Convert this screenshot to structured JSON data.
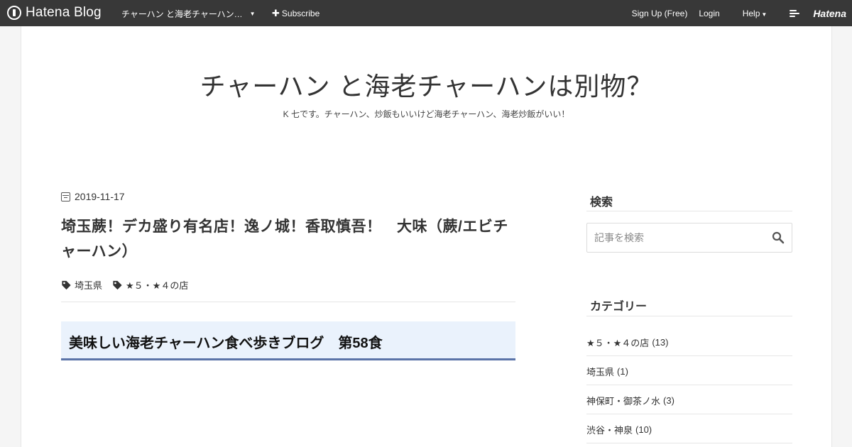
{
  "header": {
    "brand": "Hatena Blog",
    "blog_name": "チャーハン と海老チャーハン…",
    "subscribe": "Subscribe",
    "signup": "Sign Up (Free)",
    "login": "Login",
    "help": "Help",
    "hatena": "Hatena"
  },
  "blog": {
    "title": "チャーハン と海老チャーハンは別物？",
    "description": "K 七です。チャーハン、炒飯もいいけど海老チャーハン、海老炒飯がいい！"
  },
  "entry": {
    "date": "2019-11-17",
    "title": "埼玉蕨！デカ盛り有名店！逸ノ城！香取慎吾！　大味（蕨/エビチャーハン）",
    "categories": [
      "埼玉県",
      "★５・★４の店"
    ],
    "heading": "美味しい海老チャーハン食べ歩きブログ　第58食"
  },
  "sidebar": {
    "search": {
      "heading": "検索",
      "placeholder": "記事を検索"
    },
    "categories": {
      "heading": "カテゴリー",
      "items": [
        {
          "label": "★５・★４の店",
          "count": "(13)"
        },
        {
          "label": "埼玉県",
          "count": "(1)"
        },
        {
          "label": "神保町・御茶ノ水",
          "count": "(3)"
        },
        {
          "label": "渋谷・神泉",
          "count": "(10)"
        }
      ]
    }
  },
  "colors": {
    "header_bg": "#383838",
    "heading_bg": "#eaf2fc",
    "heading_border": "#5b74a8"
  }
}
